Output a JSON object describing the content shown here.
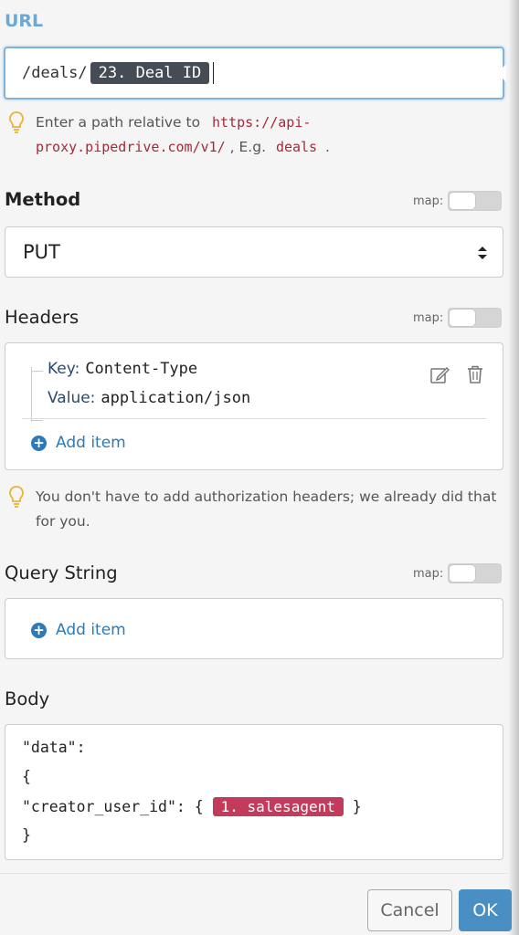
{
  "url": {
    "label": "URL",
    "prefix": "/deals/",
    "pill": "23. Deal ID",
    "hint_text": "Enter a path relative to",
    "hint_url_1": "https://api-",
    "hint_url_2": "proxy.pipedrive.com/v1/",
    "hint_eg": ", E.g.",
    "hint_example": "deals",
    "hint_end": "."
  },
  "method": {
    "label": "Method",
    "map_label": "map:",
    "value": "PUT"
  },
  "headers": {
    "label": "Headers",
    "map_label": "map:",
    "items": [
      {
        "key_label": "Key:",
        "key": "Content-Type",
        "value_label": "Value:",
        "value": "application/json"
      }
    ],
    "add_item": "Add item",
    "hint": "You don't have to add authorization headers; we already did that for you."
  },
  "query": {
    "label": "Query String",
    "map_label": "map:",
    "add_item": "Add item"
  },
  "body": {
    "label": "Body",
    "line1": "\"data\":",
    "line2": "{",
    "line3_prefix": "\"creator_user_id\": {",
    "line3_pill": "1. salesagent",
    "line3_suffix": "}",
    "line4": "}"
  },
  "footer": {
    "cancel": "Cancel",
    "ok": "OK"
  },
  "colors": {
    "accent": "#4a8fc4",
    "url_label": "#6aa8d8",
    "pill_dark": "#454c55",
    "pill_red": "#c23b5a",
    "code_red": "#a52a3a"
  }
}
